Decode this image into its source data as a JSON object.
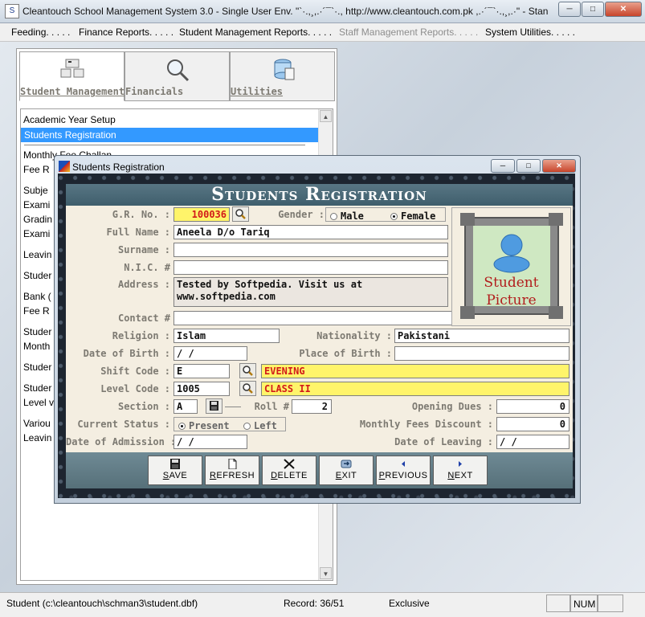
{
  "window": {
    "title": "Cleantouch School Management System 3.0 - Single User Env.      \"`·.,¸,.·´¯`·., http://www.cleantouch.com.pk ,.·´¯`·.,¸,.·\" - Stan",
    "min_label": "─",
    "max_label": "□",
    "close_label": "✕"
  },
  "menu": [
    {
      "label": "Feeding. . . . ."
    },
    {
      "label": "Finance Reports. . . . ."
    },
    {
      "label": "Student Management Reports. . . . ."
    },
    {
      "label": "Staff Management Reports. . . . .",
      "disabled": true
    },
    {
      "label": "System Utilities. . . . ."
    }
  ],
  "nav": {
    "tabs": [
      {
        "label": "Student Management",
        "active": true
      },
      {
        "label": "Financials"
      },
      {
        "label": "Utilities"
      }
    ],
    "items": [
      "Academic Year Setup",
      "Students Registration",
      "Monthly Fee Challan",
      "Fee R",
      "Subje",
      "Exami",
      "Gradin",
      "Exami",
      "Leavin",
      "Studer",
      "Bank (",
      "Fee R",
      "Studer",
      "Month",
      "Studer",
      "Studer",
      "Level v",
      "Variou",
      "Leavin"
    ],
    "selected_index": 1
  },
  "dialog": {
    "title": "Students Registration",
    "heading": "Students Registration",
    "labels": {
      "gr_no": "G.R. No. :",
      "gender": "Gender :",
      "full_name": "Full Name :",
      "surname": "Surname :",
      "nic": "N.I.C. #",
      "address": "Address :",
      "contact": "Contact #",
      "religion": "Religion :",
      "nationality": "Nationality :",
      "dob": "Date of Birth :",
      "pob": "Place of Birth :",
      "shift_code": "Shift Code :",
      "level_code": "Level Code :",
      "section": "Section :",
      "roll": "Roll #",
      "opening_dues": "Opening Dues :",
      "current_status": "Current Status :",
      "monthly_discount": "Monthly Fees Discount :",
      "doa": "Date of Admission :",
      "dol": "Date of Leaving :"
    },
    "values": {
      "gr_no": "100036",
      "full_name": "Aneela D/o Tariq",
      "surname": "",
      "nic": "",
      "address": "Tested by Softpedia. Visit us at www.softpedia.com",
      "contact": "",
      "religion": "Islam",
      "nationality": "Pakistani",
      "dob": " /  /",
      "pob": "",
      "shift_code": "E",
      "shift_name": "EVENING",
      "level_code": "1005",
      "level_name": "CLASS II",
      "section": "A",
      "roll": "2",
      "opening_dues": "0",
      "monthly_discount": "0",
      "doa": " /  /",
      "dol": " /  /"
    },
    "gender_options": {
      "male": "Male",
      "female": "Female",
      "selected": "female"
    },
    "status_options": {
      "present": "Present",
      "left": "Left",
      "selected": "present"
    },
    "picture_text_line1": "Student",
    "picture_text_line2": "Picture",
    "buttons": [
      {
        "label": "SAVE",
        "icon": "save-icon"
      },
      {
        "label": "REFRESH",
        "icon": "refresh-icon"
      },
      {
        "label": "DELETE",
        "icon": "delete-icon"
      },
      {
        "label": "EXIT",
        "icon": "exit-icon"
      },
      {
        "label": "PREVIOUS",
        "icon": "previous-icon"
      },
      {
        "label": "NEXT",
        "icon": "next-icon"
      }
    ]
  },
  "status": {
    "path": "Student (c:\\cleantouch\\schman3\\student.dbf)",
    "record": "Record: 36/51",
    "mode": "Exclusive",
    "num": "NUM"
  },
  "colors": {
    "selection": "#3399ff",
    "highlight_field": "#fff46a",
    "highlight_text": "#d21a1a"
  }
}
